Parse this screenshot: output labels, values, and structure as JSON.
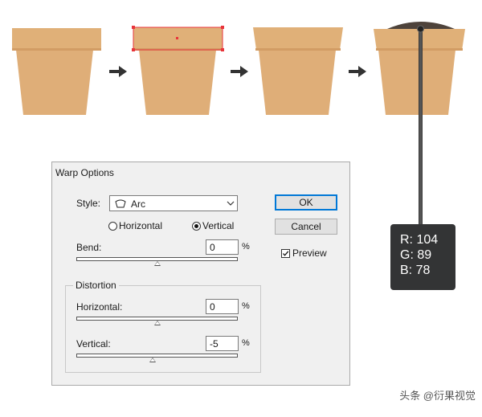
{
  "pot": {
    "rim_color": "#e0b078",
    "body_color": "#dfae78",
    "selection_color": "#e8343b",
    "soil_color": "#4e433b",
    "arrow_color": "#333333"
  },
  "dialog": {
    "title": "Warp Options",
    "style_label": "Style:",
    "style_value": "Arc",
    "orientation": {
      "horizontal_label": "Horizontal",
      "vertical_label": "Vertical",
      "selected": "Vertical"
    },
    "bend": {
      "label": "Bend:",
      "value": "0",
      "unit": "%",
      "slider_fraction": 0.5
    },
    "distortion": {
      "group_label": "Distortion",
      "horizontal": {
        "label": "Horizontal:",
        "value": "0",
        "unit": "%",
        "slider_fraction": 0.5
      },
      "vertical": {
        "label": "Vertical:",
        "value": "-5",
        "unit": "%",
        "slider_fraction": 0.475
      }
    },
    "ok_label": "OK",
    "cancel_label": "Cancel",
    "preview_label": "Preview",
    "preview_checked": true
  },
  "color_tooltip": {
    "r": "R: 104",
    "g": "G: 89",
    "b": "B: 78"
  },
  "watermark": "头条 @衍果视觉"
}
